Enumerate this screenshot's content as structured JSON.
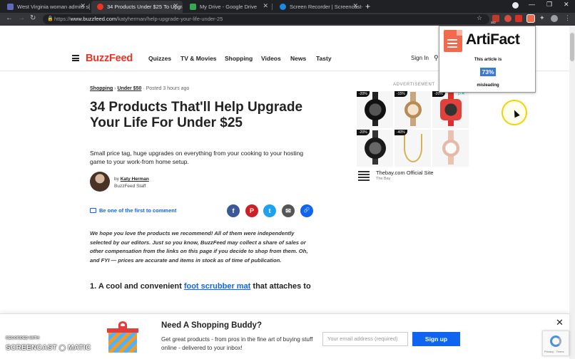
{
  "tabs": [
    {
      "title": "West Virginia woman admits she",
      "active": false,
      "favicon_color": "#5c6bc0"
    },
    {
      "title": "34 Products Under $25 To Upgra",
      "active": true,
      "favicon_color": "#e32"
    },
    {
      "title": "My Drive - Google Drive",
      "active": false,
      "favicon_color": "#34a853"
    },
    {
      "title": "Screen Recorder | Screencast-O-",
      "active": false,
      "favicon_color": "#1e88e5"
    }
  ],
  "browser": {
    "url_scheme": "https://",
    "url_host": "www.buzzfeed.com",
    "url_path": "/katyherman/help-upgrade-your-life-under-25",
    "new_tab": "+",
    "badge_count": "352"
  },
  "site_nav": {
    "logo": "BuzzFeed",
    "links": [
      "Quizzes",
      "TV & Movies",
      "Shopping",
      "Videos",
      "News",
      "Tasty"
    ],
    "sign_in": "Sign In"
  },
  "article": {
    "breadcrumb": {
      "first": "Shopping",
      "second": "Under $50",
      "sep": "›",
      "posted": "· Posted 3 hours ago"
    },
    "title": "34 Products That'll Help Upgrade Your Life For Under $25",
    "dek": "Small price tag, huge upgrades on everything from your cooking to your hosting game to your work-from home setup.",
    "author_prefix": "by",
    "author": "Katy Herman",
    "author_role": "BuzzFeed Staff",
    "comment_cta": "Be one of the first to comment",
    "disclaimer": "We hope you love the products we recommend! All of them were independently selected by our editors. Just so you know, BuzzFeed may collect a share of sales or other compensation from the links on this page if you decide to shop from them. Oh, and FYI — prices are accurate and items in stock as of time of publication.",
    "item1_prefix": "1. A cool and convenient ",
    "item1_link": "foot scrubber mat",
    "item1_suffix": " that attaches to"
  },
  "share_icons": [
    {
      "name": "facebook-icon",
      "glyph": "f",
      "color": "#3b5998"
    },
    {
      "name": "pinterest-icon",
      "glyph": "P",
      "color": "#cb2027"
    },
    {
      "name": "twitter-icon",
      "glyph": "t",
      "color": "#1da1f2"
    },
    {
      "name": "email-icon",
      "glyph": "✉",
      "color": "#555555"
    },
    {
      "name": "link-icon",
      "glyph": "🔗",
      "color": "#0f65ef"
    }
  ],
  "ad": {
    "label": "ADVERTISEMENT",
    "badges": [
      "-20%",
      "-15%",
      "-20%",
      "-20%",
      "-40%",
      ""
    ],
    "site": "Thebay.com Official Site",
    "brand": "The Bay"
  },
  "artifact_popup": {
    "brand": "ArtiFact",
    "line1": "This article is",
    "percent": "73%",
    "line2": "misleading"
  },
  "banner": {
    "title": "Need A Shopping Buddy?",
    "text": "Get great products - from pros in the fine art of buying stuff online - delivered to your inbox!",
    "input_placeholder": "Your email address (required)",
    "button": "Sign up",
    "close": "✕"
  },
  "watermark": {
    "line1": "RECORDED WITH",
    "line2": "SCREENCAST ◉ MATIC"
  }
}
